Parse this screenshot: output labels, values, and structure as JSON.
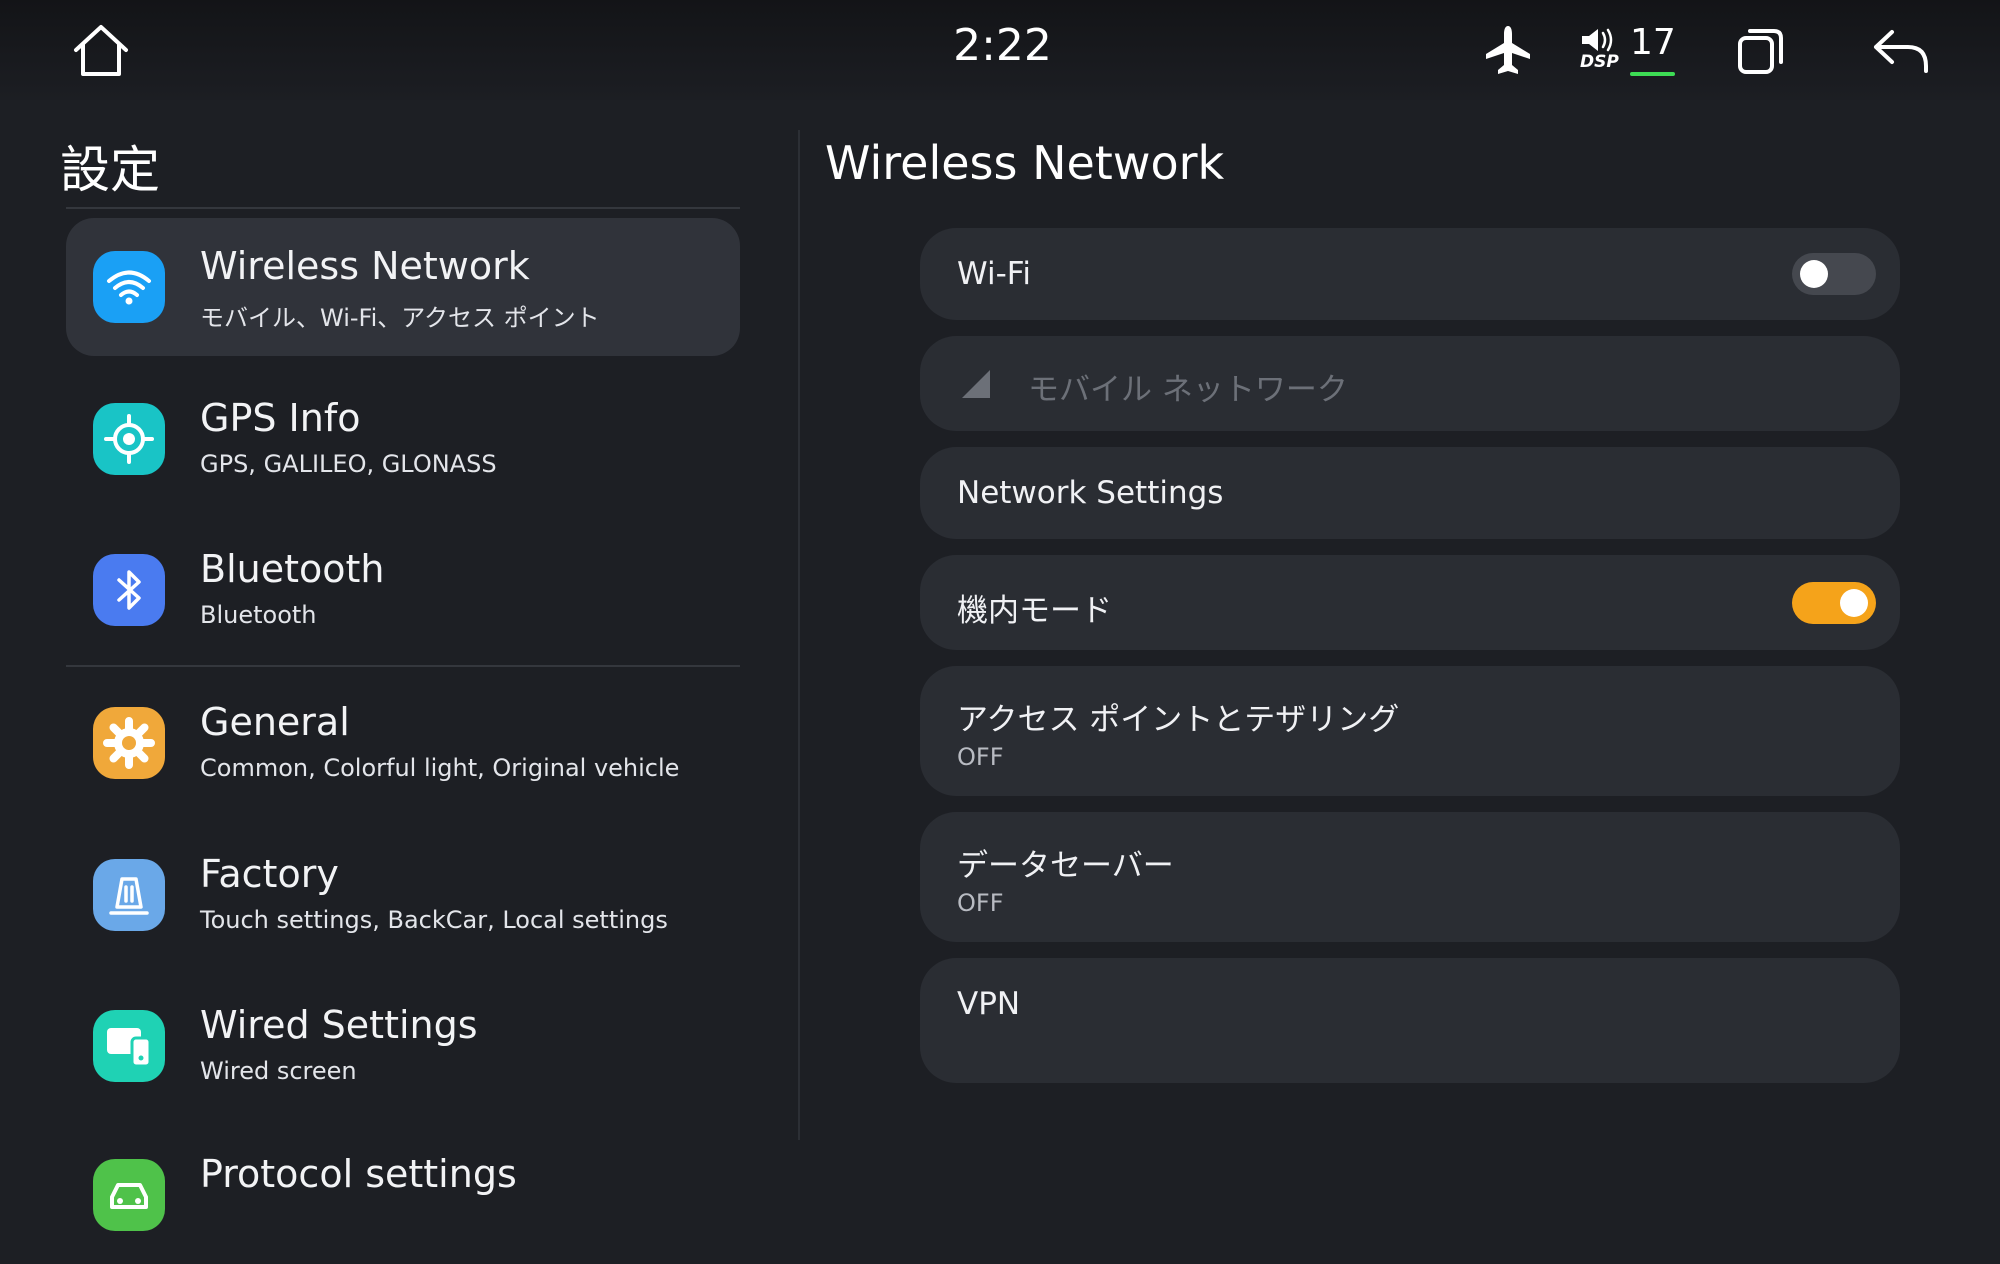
{
  "status_bar": {
    "time": "2:22",
    "volume_label": "DSP",
    "volume_level": "17",
    "icons": [
      "home-icon",
      "airplane-icon",
      "volume-dsp-icon",
      "recent-apps-icon",
      "back-icon"
    ]
  },
  "settings": {
    "title": "設定",
    "items": [
      {
        "title": "Wireless Network",
        "subtitle": "モバイル、Wi-Fi、アクセス ポイント",
        "icon": "wifi-icon",
        "color": "#1aa0f5"
      },
      {
        "title": "GPS Info",
        "subtitle": "GPS, GALILEO, GLONASS",
        "icon": "gps-icon",
        "color": "#19c4c6"
      },
      {
        "title": "Bluetooth",
        "subtitle": "Bluetooth",
        "icon": "bluetooth-icon",
        "color": "#4a7bf0"
      },
      {
        "title": "General",
        "subtitle": "Common, Colorful light, Original vehicle",
        "icon": "gear-icon",
        "color": "#f0a83a"
      },
      {
        "title": "Factory",
        "subtitle": "Touch settings, BackCar, Local settings",
        "icon": "factory-icon",
        "color": "#6aa8e8"
      },
      {
        "title": "Wired Settings",
        "subtitle": "Wired screen",
        "icon": "wired-screen-icon",
        "color": "#1fd2b4"
      },
      {
        "title": "Protocol settings",
        "subtitle": "",
        "icon": "car-icon",
        "color": "#4fc24a"
      }
    ]
  },
  "wireless": {
    "title": "Wireless Network",
    "wifi": {
      "label": "Wi-Fi",
      "enabled": false
    },
    "mobile_network": {
      "label": "モバイル ネットワーク",
      "disabled": true
    },
    "network_settings": {
      "label": "Network Settings"
    },
    "airplane_mode": {
      "label": "機内モード",
      "enabled": true
    },
    "hotspot": {
      "label": "アクセス ポイントとテザリング",
      "status": "OFF"
    },
    "data_saver": {
      "label": "データセーバー",
      "status": "OFF"
    },
    "vpn": {
      "label": "VPN"
    }
  },
  "colors": {
    "accent": "#f5a31a",
    "background": "#1d1f24",
    "card": "#2a2d33",
    "selected": "#30333a"
  }
}
